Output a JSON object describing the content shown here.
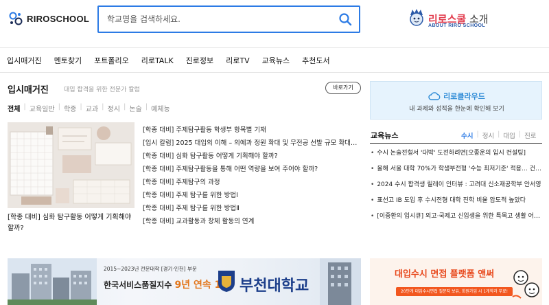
{
  "header": {
    "logo_text": "RIROSCHOOL",
    "search_placeholder": "학교명을 검색하세요.",
    "about_title_main": "리로스쿨",
    "about_title_suffix": " 소개",
    "about_subtitle": "ABOUT RIRO SCHOOL"
  },
  "nav": {
    "items": [
      "입시매거진",
      "멘토찾기",
      "포트폴리오",
      "리로TALK",
      "진로정보",
      "리로TV",
      "교육뉴스",
      "추천도서"
    ]
  },
  "magazine": {
    "title": "입시매거진",
    "subtitle": "대입 합격을 위한 전문가 칼럼",
    "more_label": "바로가기",
    "tabs": [
      "전체",
      "교육일반",
      "학종",
      "교과",
      "정시",
      "논술",
      "예체능"
    ],
    "active_tab": "전체",
    "featured_caption": "[학종 대비] 심화 탐구활동 어떻게 기획해야 할까?",
    "articles": [
      "[학종 대비] 주제탐구활동 학생부 항목별 기재",
      "[입시 칼럼] 2025 대입의 이해 – 의예과 정원 확대 및 무전공 선발 규모 확대의 ...",
      "[학종 대비] 심화 탐구활동 어떻게 기획해야 할까?",
      "[학종 대비] 주제탐구활동을 통해 어떤 역량을 보여 주어야 할까?",
      "[학종 대비] 주제탐구의 과정",
      "[학종 대비] 주제 탐구를 위한 방법Ⅰ",
      "[학종 대비] 주제 탐구를 위한 방법Ⅱ",
      "[학종 대비] 교과활동과 창체 활동의 연계"
    ]
  },
  "cloud": {
    "title": "리로클라우드",
    "subtitle": "내 과제와 성적을 한눈에 확인해 보기"
  },
  "news": {
    "title": "교육뉴스",
    "tabs": [
      "수시",
      "정시",
      "대입",
      "진로"
    ],
    "active_tab": "수시",
    "items": [
      "수시 논술전형서 '대박' 도전하려면[오종운의 입시 컨설팅]",
      "올해 서울 대학 70%가 학생부전형 '수능 최저기준' 적용… 건국대...",
      "2024 수시 합격생 릴레이 인터뷰 : 고려대 신소재공학부 안서영",
      "표선고 IB 도입 후 수시전형 대학 진학 비율 압도적 높았다",
      "[이중환의 입시큐] 외고·국제고 신입생을 위한 특목고 생활 어드..."
    ]
  },
  "banners": {
    "left_top": "2015~2023년 전문대학 [경기·인천] 부문",
    "left_main_a": "한국서비스품질지수 ",
    "left_main_em": "9년 연속 1",
    "left_main_b": "위",
    "left_univ": "부천대학교",
    "right_title": "대입수시 면접 플랫폼 앤써",
    "right_sub": "20만개 대입수시면접 질문지 보유, 회원가입 시 1개학과 무료!"
  },
  "colors": {
    "accent": "#2c7be5",
    "brand_red": "#e23d4e",
    "cloud_bg": "#e6f3fd",
    "banner_orange": "#e8491d"
  }
}
